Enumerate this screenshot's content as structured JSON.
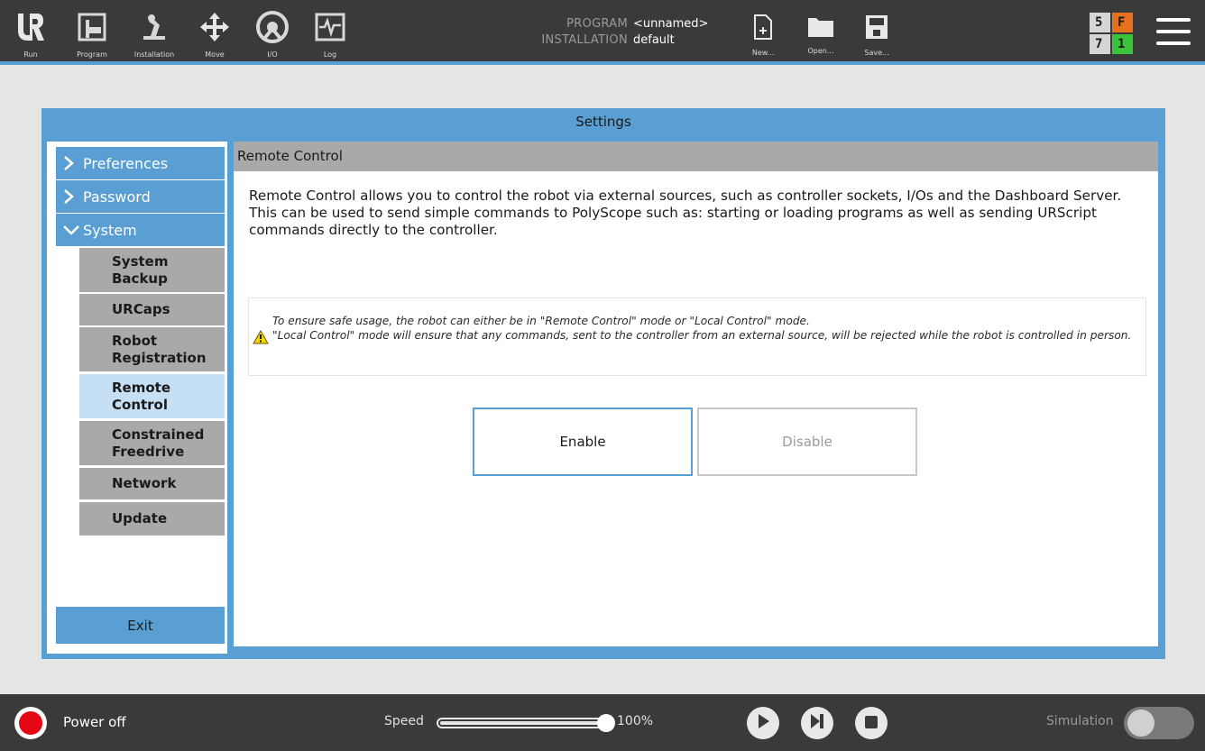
{
  "topbar": {
    "nav": [
      {
        "label": "Run",
        "icon": "ur-logo-icon"
      },
      {
        "label": "Program",
        "icon": "program-icon"
      },
      {
        "label": "Installation",
        "icon": "installation-icon"
      },
      {
        "label": "Move",
        "icon": "move-icon"
      },
      {
        "label": "I/O",
        "icon": "io-icon"
      },
      {
        "label": "Log",
        "icon": "log-icon"
      }
    ],
    "program_key": "PROGRAM",
    "program_value": "<unnamed>",
    "installation_key": "INSTALLATION",
    "installation_value": "default",
    "file": [
      {
        "label": "New...",
        "icon": "new-file-icon"
      },
      {
        "label": "Open...",
        "icon": "open-folder-icon"
      },
      {
        "label": "Save...",
        "icon": "save-icon"
      }
    ],
    "status": {
      "top_left": "5",
      "top_right": "F",
      "bottom_left": "7",
      "bottom_right": "1",
      "colors": {
        "neutral": "#d6d6d6",
        "fault": "#e8711e",
        "ok": "#3bc43b"
      }
    }
  },
  "settings": {
    "title": "Settings",
    "sidebar": {
      "preferences": "Preferences",
      "password": "Password",
      "system": "System",
      "sub_items": [
        "System Backup",
        "URCaps",
        "Robot Registration",
        "Remote Control",
        "Constrained Freedrive",
        "Network",
        "Update"
      ],
      "active_sub_item": "Remote Control",
      "exit": "Exit"
    },
    "content": {
      "header": "Remote Control",
      "description_1": "Remote Control allows you to control the robot via external sources, such as controller sockets, I/Os and the Dashboard Server.",
      "description_2": "This can be used to send simple commands to PolyScope such as: starting or loading programs as well as sending URScript commands directly to the controller.",
      "warning_1": "To ensure safe usage, the robot can either be in \"Remote Control\" mode or \"Local Control\" mode.",
      "warning_2": "\"Local Control\" mode will ensure that any commands, sent to the controller from an external source, will be rejected while the robot is controlled in person.",
      "enable": "Enable",
      "disable": "Disable"
    }
  },
  "footer": {
    "power": "Power off",
    "speed_label": "Speed",
    "speed_value": "100%",
    "speed_fraction": 1.0,
    "simulation": "Simulation",
    "simulation_on": false
  },
  "colors": {
    "accent": "#5a9fd4",
    "bar": "#3a3a3a",
    "power_off": "#e30613"
  }
}
